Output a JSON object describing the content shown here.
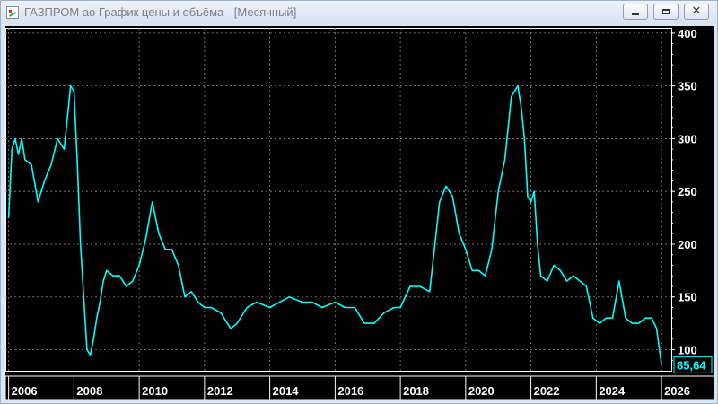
{
  "window": {
    "title": "ГАЗПРОМ ао График цены и объёма - [Месячный]",
    "buttons": {
      "minimize": "minimize-icon",
      "maximize": "maximize-icon",
      "close": "close-icon"
    }
  },
  "chart_data": {
    "type": "line",
    "title": "",
    "xlabel": "",
    "ylabel": "",
    "x_ticks": [
      "2006",
      "2008",
      "2010",
      "2012",
      "2014",
      "2016",
      "2018",
      "2020",
      "2022",
      "2024",
      "2026"
    ],
    "y_ticks": [
      100,
      150,
      200,
      250,
      300,
      350,
      400
    ],
    "ylim": [
      80,
      405
    ],
    "xlim": [
      2005.9,
      2026.3
    ],
    "grid": true,
    "last_value_label": "85,64",
    "series": [
      {
        "x": [
          2006.0,
          2006.1,
          2006.2,
          2006.3,
          2006.4,
          2006.5,
          2006.7,
          2006.9,
          2007.1,
          2007.3,
          2007.5,
          2007.7,
          2007.9,
          2008.0,
          2008.1,
          2008.2,
          2008.3,
          2008.4,
          2008.5,
          2008.6,
          2008.7,
          2008.8,
          2008.9,
          2009.0,
          2009.2,
          2009.4,
          2009.6,
          2009.8,
          2010.0,
          2010.2,
          2010.4,
          2010.6,
          2010.8,
          2011.0,
          2011.2,
          2011.4,
          2011.6,
          2011.8,
          2012.0,
          2012.2,
          2012.5,
          2012.8,
          2013.0,
          2013.3,
          2013.6,
          2014.0,
          2014.3,
          2014.6,
          2015.0,
          2015.3,
          2015.6,
          2016.0,
          2016.3,
          2016.6,
          2016.9,
          2017.2,
          2017.5,
          2017.8,
          2018.0,
          2018.3,
          2018.6,
          2018.9,
          2019.2,
          2019.4,
          2019.6,
          2019.8,
          2020.0,
          2020.2,
          2020.4,
          2020.6,
          2020.8,
          2021.0,
          2021.2,
          2021.4,
          2021.6,
          2021.7,
          2021.8,
          2021.9,
          2022.0,
          2022.1,
          2022.2,
          2022.3,
          2022.5,
          2022.7,
          2022.9,
          2023.1,
          2023.3,
          2023.5,
          2023.7,
          2023.9,
          2024.1,
          2024.3,
          2024.5,
          2024.7,
          2024.9,
          2025.1,
          2025.3,
          2025.5,
          2025.7,
          2025.85,
          2026.0
        ],
        "values": [
          225,
          290,
          300,
          285,
          300,
          280,
          275,
          240,
          260,
          275,
          300,
          290,
          350,
          345,
          280,
          200,
          150,
          100,
          95,
          110,
          130,
          145,
          165,
          175,
          170,
          170,
          160,
          165,
          180,
          205,
          240,
          210,
          195,
          195,
          180,
          150,
          155,
          145,
          140,
          140,
          135,
          120,
          125,
          140,
          145,
          140,
          145,
          150,
          145,
          145,
          140,
          145,
          140,
          140,
          125,
          125,
          135,
          140,
          140,
          160,
          160,
          155,
          240,
          255,
          245,
          210,
          195,
          175,
          175,
          170,
          195,
          250,
          280,
          340,
          350,
          330,
          300,
          245,
          240,
          250,
          200,
          170,
          165,
          180,
          175,
          165,
          170,
          165,
          160,
          130,
          125,
          130,
          130,
          165,
          130,
          125,
          125,
          130,
          130,
          120,
          85.64
        ]
      }
    ]
  }
}
